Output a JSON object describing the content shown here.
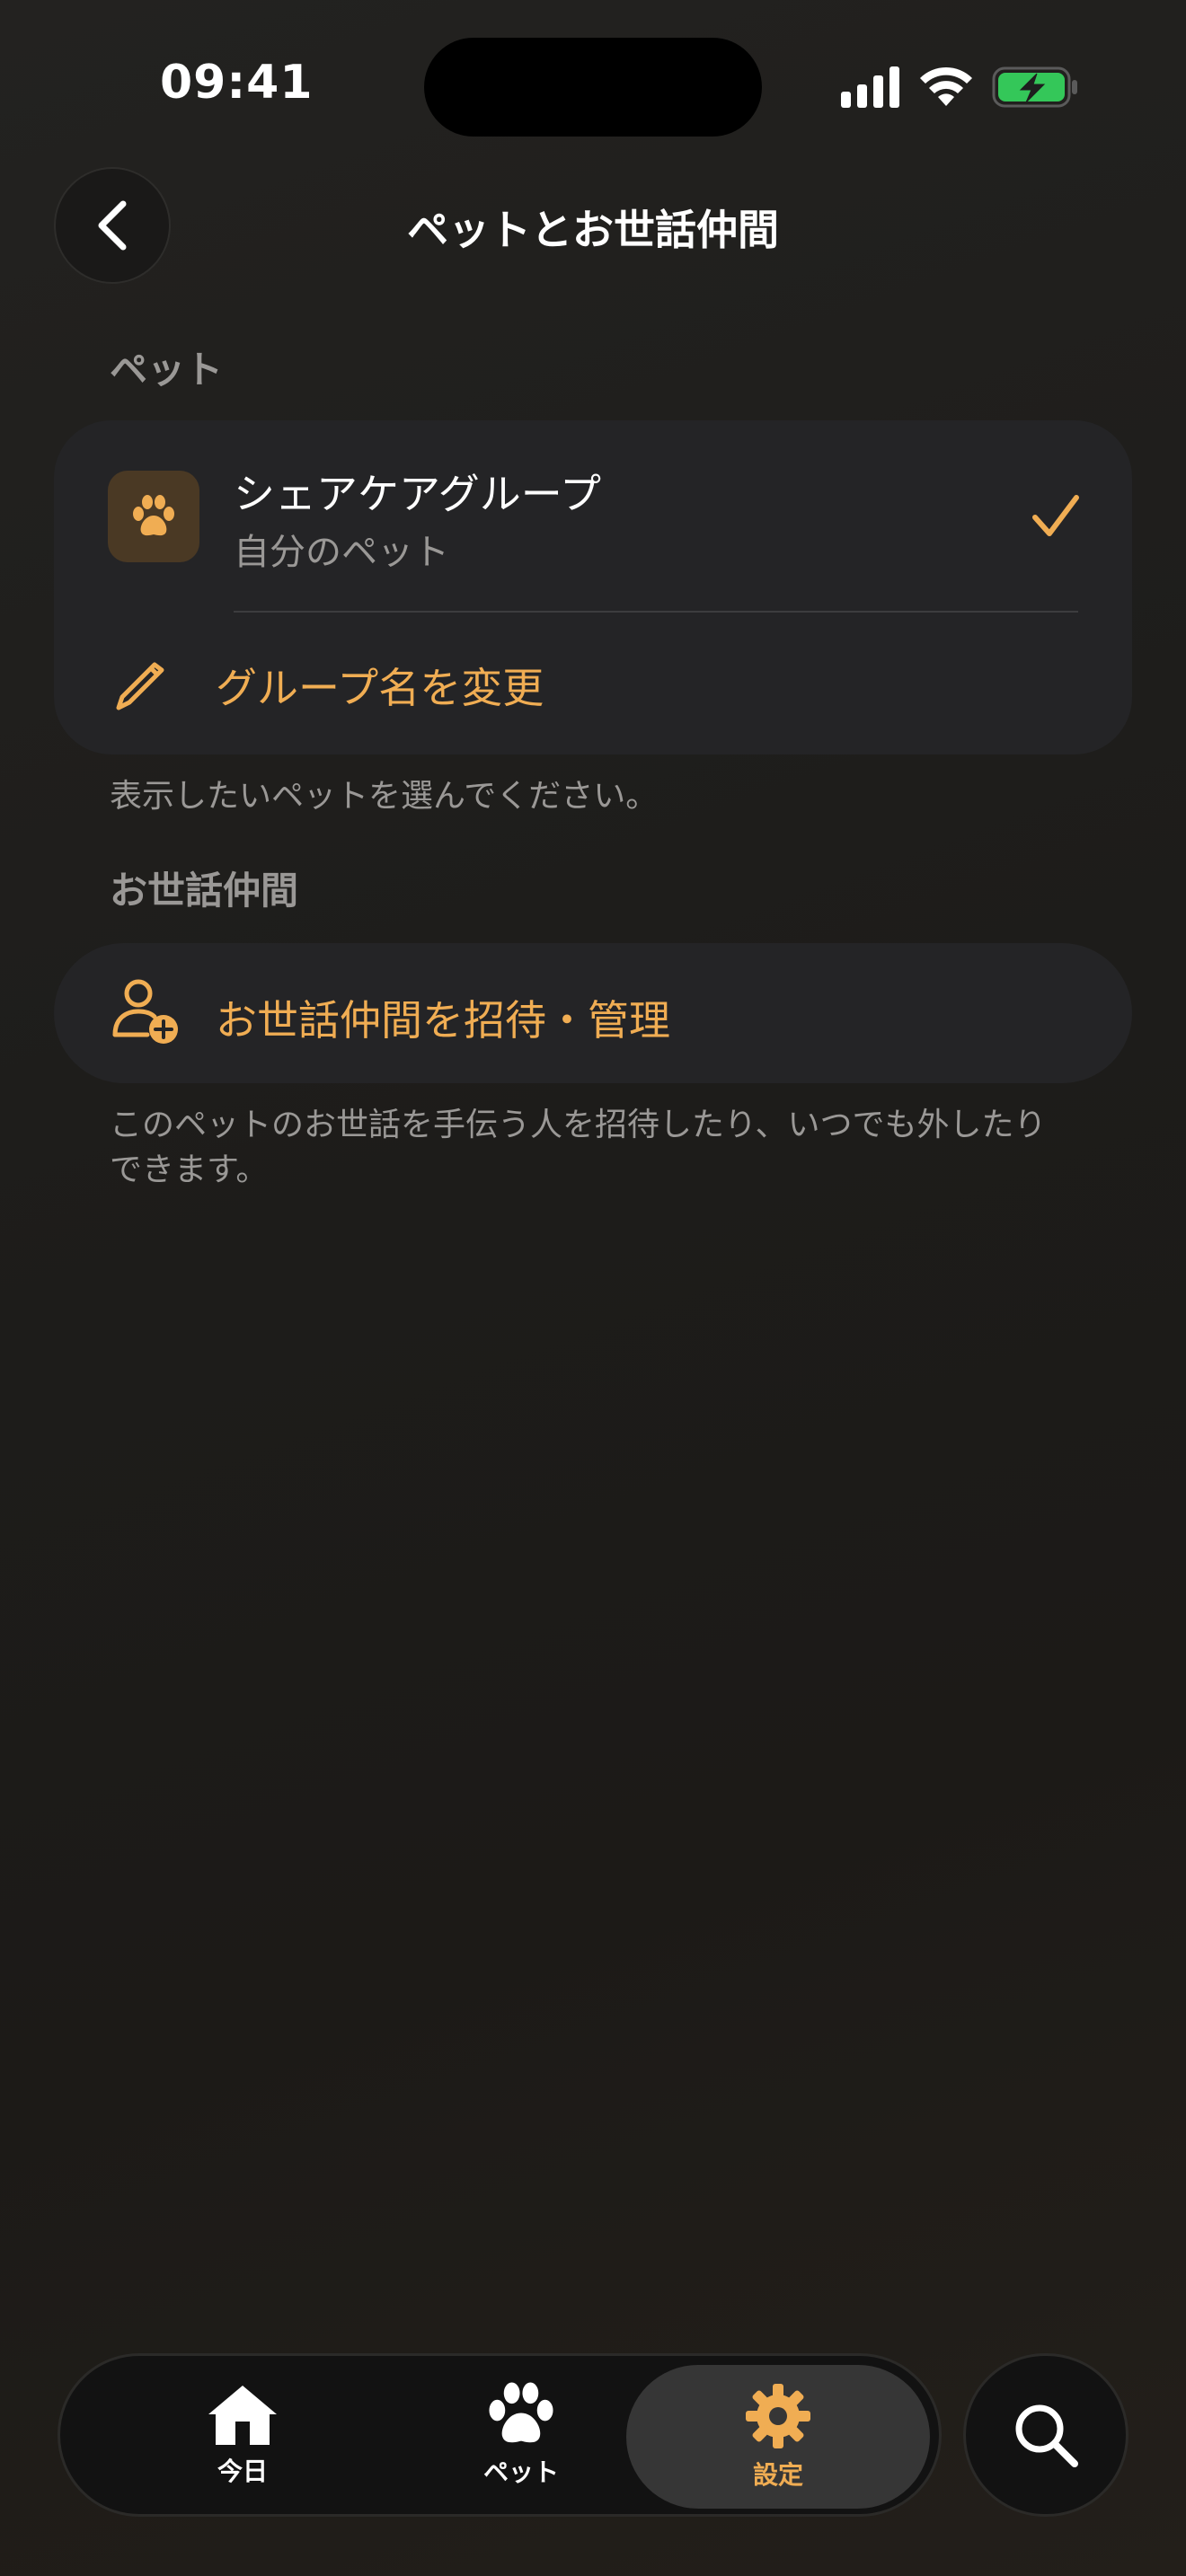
{
  "status": {
    "time": "09:41"
  },
  "nav": {
    "title": "ペットとお世話仲間"
  },
  "pets": {
    "header": "ペット",
    "group_name": "シェアケアグループ",
    "group_sub": "自分のペット",
    "rename_label": "グループ名を変更",
    "helper": "表示したいペットを選んでください。"
  },
  "caregivers": {
    "header": "お世話仲間",
    "invite_label": "お世話仲間を招待・管理",
    "helper_line1": "このペットのお世話を手伝う人を招待したり、いつでも外したり",
    "helper_line2": "できます。"
  },
  "tabs": [
    {
      "label": "今日",
      "icon": "home-icon"
    },
    {
      "label": "ペット",
      "icon": "paw-icon"
    },
    {
      "label": "設定",
      "icon": "gear-icon"
    }
  ],
  "colors": {
    "accent": "#f0ad53",
    "battery": "#34c759"
  }
}
